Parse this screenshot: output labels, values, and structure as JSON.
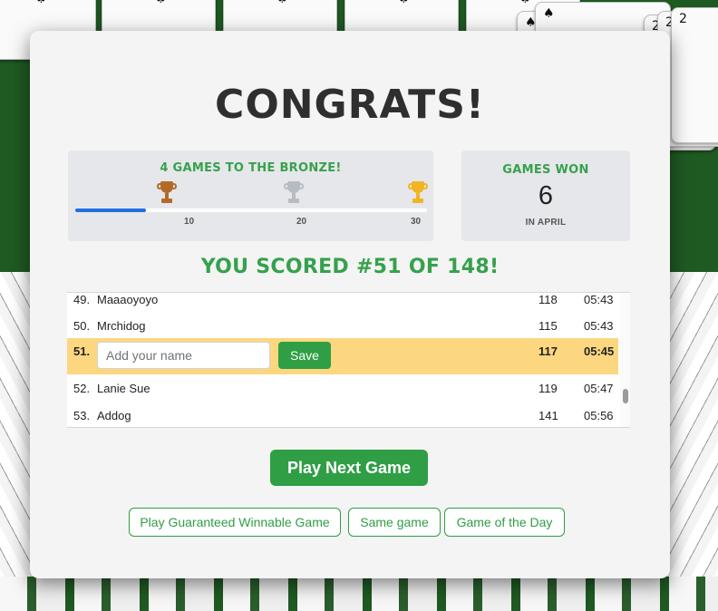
{
  "background": {
    "card_pip": "♠",
    "fan_cards": [
      "♠",
      "♠",
      "2",
      "2",
      "2"
    ]
  },
  "modal": {
    "title": "Congrats!",
    "progress": {
      "heading": "4 games to the Bronze!",
      "fill_fraction": 0.2,
      "milestones": [
        "10",
        "20",
        "30"
      ],
      "trophies": [
        "bronze-trophy-icon",
        "silver-trophy-icon",
        "gold-trophy-icon"
      ]
    },
    "games_won": {
      "heading": "Games Won",
      "count": "6",
      "caption": "IN APRIL"
    },
    "score_line": "You scored #51 of 148!",
    "leaderboard": {
      "rows": [
        {
          "rank": "49.",
          "name": "Maaaoyoyo",
          "score": "118",
          "time": "05:43"
        },
        {
          "rank": "50.",
          "name": "Mrchidog",
          "score": "115",
          "time": "05:43"
        },
        {
          "rank": "51.",
          "name": "",
          "score": "117",
          "time": "05:45"
        },
        {
          "rank": "52.",
          "name": "Lanie Sue",
          "score": "119",
          "time": "05:47"
        },
        {
          "rank": "53.",
          "name": "Addog",
          "score": "141",
          "time": "05:56"
        }
      ],
      "name_placeholder": "Add your name",
      "save_label": "Save"
    },
    "buttons": {
      "play_next": "Play Next Game",
      "guaranteed": "Play Guaranteed Winnable Game",
      "same_game": "Same game",
      "game_of_day": "Game of the Day"
    }
  },
  "colors": {
    "accent_green": "#2f9e45",
    "highlight_row": "#fdd780",
    "progress_blue": "#1f6fe0",
    "felt": "#1f5a23"
  }
}
